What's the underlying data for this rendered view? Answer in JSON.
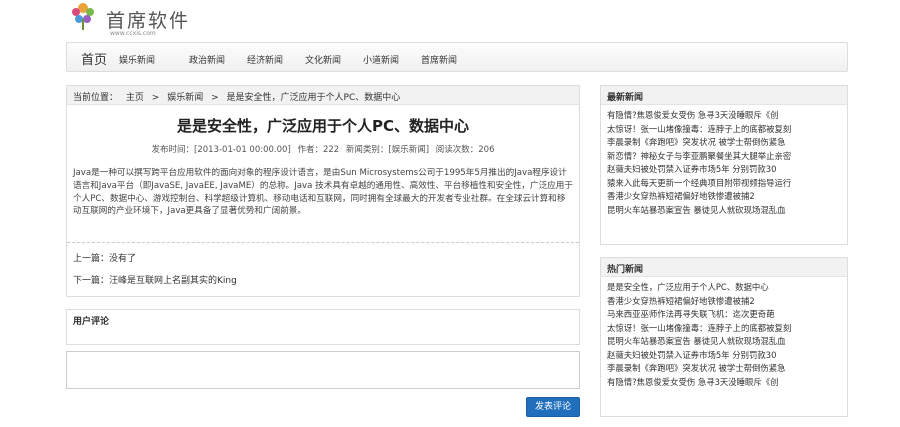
{
  "logo": {
    "text": "首席软件",
    "url": "www.ccxis.com"
  },
  "nav": {
    "home": "首页",
    "items": [
      "娱乐新闻",
      "政治新闻",
      "经济新闻",
      "文化新闻",
      "小道新闻",
      "首席新闻"
    ]
  },
  "breadcrumb": {
    "label": "当前位置：",
    "home": "主页",
    "sep": ">",
    "category": "娱乐新闻",
    "current": "是是安全性，广泛应用于个人PC、数据中心"
  },
  "article": {
    "title": "是是安全性，广泛应用于个人PC、数据中心",
    "meta": {
      "published": "发布时间：[2013-01-01 00:00.00]",
      "author": "作者：222",
      "category": "新闻类别：[娱乐新闻]",
      "reads": "阅读次数：206"
    },
    "body": "Java是一种可以撰写跨平台应用软件的面向对象的程序设计语言，是由Sun Microsystems公司于1995年5月推出的Java程序设计语言和Java平台（即JavaSE, JavaEE, JavaME）的总称。Java 技术具有卓越的通用性、高效性、平台移植性和安全性，广泛应用于个人PC、数据中心、游戏控制台、科学超级计算机、移动电话和互联网，同时拥有全球最大的开发者专业社群。在全球云计算和移动互联网的产业环境下，Java更具备了显著优势和广阔前景。",
    "prev": "上一篇：没有了",
    "next": "下一篇：汪峰是互联网上名副其实的King"
  },
  "comments": {
    "heading": "用户评论",
    "submit": "发表评论"
  },
  "sidebar": {
    "latest": {
      "heading": "最新新闻",
      "items": [
        "有隐情?焦恩俊爱女受伤 急寻3天没睡眼斥《创",
        "太惊讶！张一山堵像撞毒：连脖子上的底都被复刻",
        "李晨录制《奔跑吧》突发状况 被学士帮倒伤紧急",
        "新恋情？神秘女子与李亚鹏聚餐坐其大腿举止亲密",
        "赵薇夫妇被处罚禁入证券市场5年 分别罚款30",
        "猿来入此每天更新一个经典项目附带视频指导运行",
        "香港少女穿热裤短裙偏好地铁惨遭被捕2",
        "昆明火车站暴恐案宣告 暴徒见人就砍现场混乱血"
      ]
    },
    "hot": {
      "heading": "热门新闻",
      "items": [
        "是是安全性，广泛应用于个人PC、数据中心",
        "香港少女穿热裤短裙偏好地铁惨遭被捕2",
        "马来西亚巫师作法再寻失联飞机：迄次更奇葩",
        "太惊讶！张一山堵像撞毒：连脖子上的底都被复刻",
        "昆明火车站暴恐案宣告 暴徒见人就砍现场混乱血",
        "赵薇夫妇被处罚禁入证券市场5年 分别罚款30",
        "李晨录制《奔跑吧》突发状况 被学士帮倒伤紧急",
        "有隐情?焦恩俊爱女受伤 急寻3天没睡眼斥《创"
      ]
    }
  },
  "colors": {
    "button": "#1f6fbd",
    "border": "#dddddd",
    "header_bg": "#f2f2f2"
  }
}
